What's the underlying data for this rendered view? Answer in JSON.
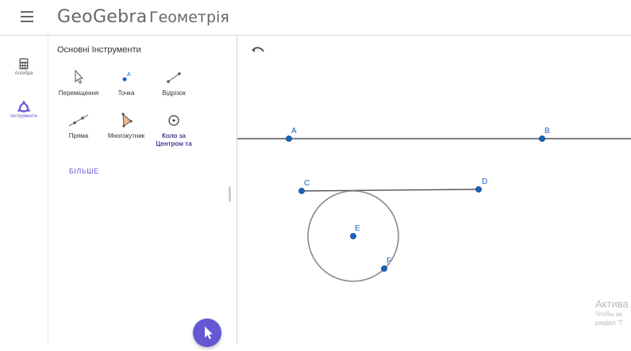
{
  "header": {
    "logo_text": "GeoGebra",
    "app_title": "Геометрія"
  },
  "sidebar": {
    "items": [
      {
        "label": "Алгебра",
        "icon": "calculator-icon",
        "active": false
      },
      {
        "label": "Інструменти",
        "icon": "tools-icon",
        "active": true
      }
    ]
  },
  "tools_panel": {
    "title": "Основні Інструменти",
    "tools": [
      {
        "label": "Переміщення",
        "icon": "move-arrow-icon"
      },
      {
        "label": "Точка",
        "icon": "point-icon"
      },
      {
        "label": "Відрізок",
        "icon": "segment-icon"
      },
      {
        "label": "Пряма",
        "icon": "line-icon"
      },
      {
        "label": "Многокутник",
        "icon": "polygon-icon"
      },
      {
        "label": "Коло за Центром та",
        "icon": "circle-center-icon",
        "active": true
      }
    ],
    "more_label": "БІЛЬШЕ"
  },
  "canvas": {
    "points": [
      {
        "label": "A"
      },
      {
        "label": "B"
      },
      {
        "label": "C"
      },
      {
        "label": "D"
      },
      {
        "label": "E"
      },
      {
        "label": "F"
      }
    ]
  },
  "watermark": {
    "title": "Актива",
    "line1": "Чтобы ак",
    "line2": "раздел \"Г"
  },
  "colors": {
    "accent": "#6557d2",
    "point_fill": "#1565c0",
    "point_label": "#1565c0",
    "line": "#555555",
    "circle": "#888888"
  }
}
